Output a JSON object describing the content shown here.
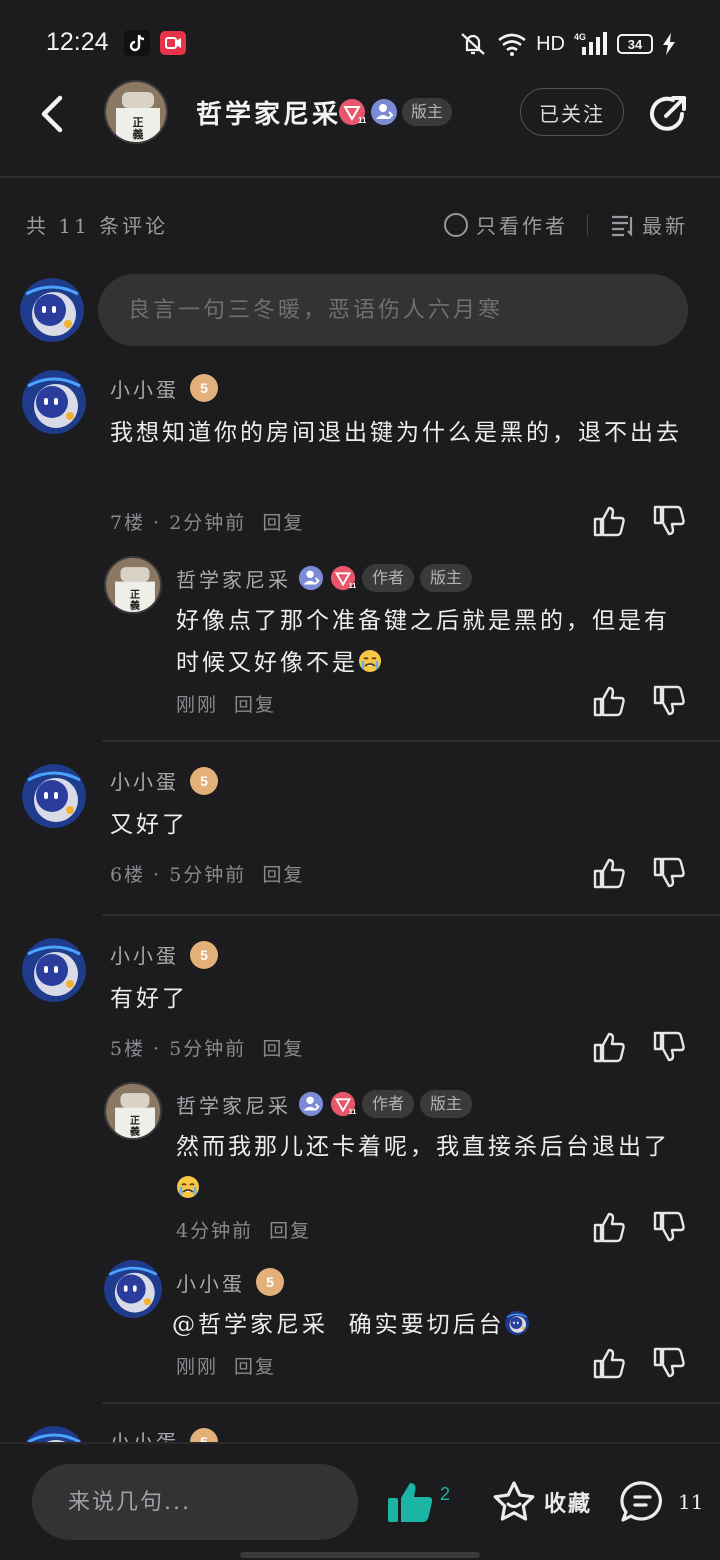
{
  "status_bar": {
    "time": "12:24",
    "network": "HD",
    "signal_label": "4G",
    "battery": "34"
  },
  "header": {
    "title": "哲学家尼采",
    "host_tag": "版主",
    "follow_label": "已关注"
  },
  "comment_header": {
    "count": "共 11 条评论",
    "only_author": "只看作者",
    "sort": "最新"
  },
  "input": {
    "placeholder": "良言一句三冬暖，恶语伤人六月寒"
  },
  "comments": [
    {
      "user": "小小蛋",
      "level": "5",
      "text": "我想知道你的房间退出键为什么是黑的，退不出去",
      "floor": "7楼",
      "time": "2分钟前",
      "reply": "回复",
      "sub_reply": {
        "user": "哲学家尼采",
        "tags": [
          "作者",
          "版主"
        ],
        "text": "好像点了那个准备键之后就是黑的，但是有时候又好像不是",
        "time": "刚刚",
        "reply": "回复"
      }
    },
    {
      "user": "小小蛋",
      "level": "5",
      "text": "又好了",
      "floor": "6楼",
      "time": "5分钟前",
      "reply": "回复"
    },
    {
      "user": "小小蛋",
      "level": "5",
      "text": "有好了",
      "floor": "5楼",
      "time": "5分钟前",
      "reply": "回复",
      "sub_replies": [
        {
          "user": "哲学家尼采",
          "tags": [
            "作者",
            "版主"
          ],
          "text": "然而我那儿还卡着呢，我直接杀后台退出了",
          "time": "4分钟前",
          "reply": "回复"
        },
        {
          "user": "小小蛋",
          "level": "5",
          "mention": "@哲学家尼采",
          "text": "确实要切后台",
          "time": "刚刚",
          "reply": "回复"
        }
      ]
    },
    {
      "user": "小小蛋",
      "level": "5"
    }
  ],
  "bottom_bar": {
    "placeholder": "来说几句...",
    "like_count": "2",
    "favorite_label": "收藏",
    "comment_count": "11"
  },
  "colors": {
    "background": "#1c1c1e",
    "accent_like": "#1bb4a5",
    "level_badge": "#e3b07a",
    "record_icon": "#e8334a"
  }
}
